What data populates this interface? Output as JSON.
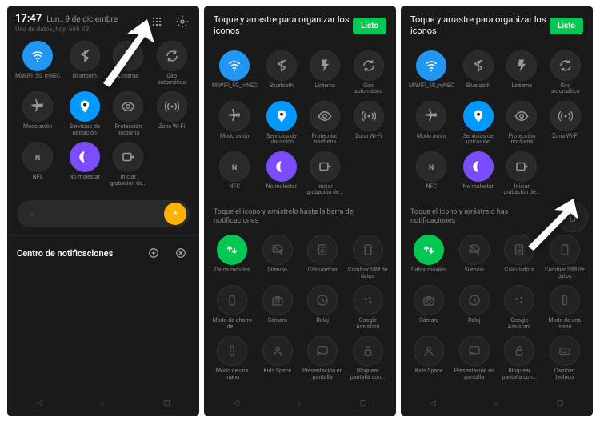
{
  "status": {
    "time": "17:47",
    "date": "Lun., 9 de diciembre",
    "usage": "Uso de datos, hoy: 668 KB"
  },
  "edit": {
    "title": "Toque y arrastre para organizar los iconos",
    "done": "Listo",
    "hint": "Toque el icono y arrástrelo hasta la barra de notificaciones"
  },
  "notif_center": "Centro de notificaciones",
  "tiles_main": [
    {
      "label": "MIWIFI_5G_mNEC",
      "icon": "wifi",
      "state": "on"
    },
    {
      "label": "Bluetooth",
      "icon": "bt",
      "state": "off"
    },
    {
      "label": "Linterna",
      "icon": "flash",
      "state": "off"
    },
    {
      "label": "Giro automático",
      "icon": "rotate",
      "state": "off"
    },
    {
      "label": "Modo avión",
      "icon": "plane",
      "state": "off"
    },
    {
      "label": "Servicios de ubicación",
      "icon": "loc",
      "state": "loc"
    },
    {
      "label": "Protección nocturna",
      "icon": "eye",
      "state": "off"
    },
    {
      "label": "Zona Wi-Fi",
      "icon": "hotspot",
      "state": "off"
    },
    {
      "label": "NFC",
      "icon": "nfc",
      "state": "off"
    },
    {
      "label": "No molestar",
      "icon": "dnd",
      "state": "dnd"
    },
    {
      "label": "Iniciar grabación de...",
      "icon": "rec",
      "state": "off"
    }
  ],
  "tiles_more": [
    {
      "label": "Datos móviles",
      "icon": "data",
      "state": "data"
    },
    {
      "label": "Silencio",
      "icon": "mute",
      "state": "dim"
    },
    {
      "label": "Calculadora",
      "icon": "calc",
      "state": "dim"
    },
    {
      "label": "Cambiar SIM de datos",
      "icon": "sim",
      "state": "dim"
    },
    {
      "label": "Modo de ahorro de...",
      "icon": "battery",
      "state": "dim"
    },
    {
      "label": "Cámara",
      "icon": "cam",
      "state": "dim"
    },
    {
      "label": "Reloj",
      "icon": "clock",
      "state": "dim"
    },
    {
      "label": "Google Assistant",
      "icon": "assist",
      "state": "dim"
    },
    {
      "label": "Modo de una mano",
      "icon": "hand",
      "state": "dim"
    },
    {
      "label": "Kids Space",
      "icon": "kids",
      "state": "dim"
    },
    {
      "label": "Presentación en pantalla",
      "icon": "cast",
      "state": "dim"
    },
    {
      "label": "Bloquear pantalla con...",
      "icon": "lock",
      "state": "dim"
    }
  ],
  "tiles_more_b": [
    {
      "label": "Datos móviles",
      "icon": "data",
      "state": "data"
    },
    {
      "label": "Silencio",
      "icon": "mute",
      "state": "dim"
    },
    {
      "label": "Calculadora",
      "icon": "calc",
      "state": "dim"
    },
    {
      "label": "Cambiar SIM de datos",
      "icon": "sim",
      "state": "dim"
    },
    {
      "label": "Cámara",
      "icon": "cam",
      "state": "dim"
    },
    {
      "label": "Reloj",
      "icon": "clock",
      "state": "dim"
    },
    {
      "label": "Google Assistant",
      "icon": "assist",
      "state": "dim"
    },
    {
      "label": "Modo de una mano",
      "icon": "hand",
      "state": "dim"
    },
    {
      "label": "Kids Space",
      "icon": "kids",
      "state": "dim"
    },
    {
      "label": "Presentación en pantalla",
      "icon": "cast",
      "state": "dim"
    },
    {
      "label": "Bloquear pantalla con...",
      "icon": "lock",
      "state": "dim"
    },
    {
      "label": "Cambiar teclado",
      "icon": "kbd",
      "state": "dim"
    }
  ],
  "hint_short": "Toque el icono y arrástrelo has notificaciones"
}
